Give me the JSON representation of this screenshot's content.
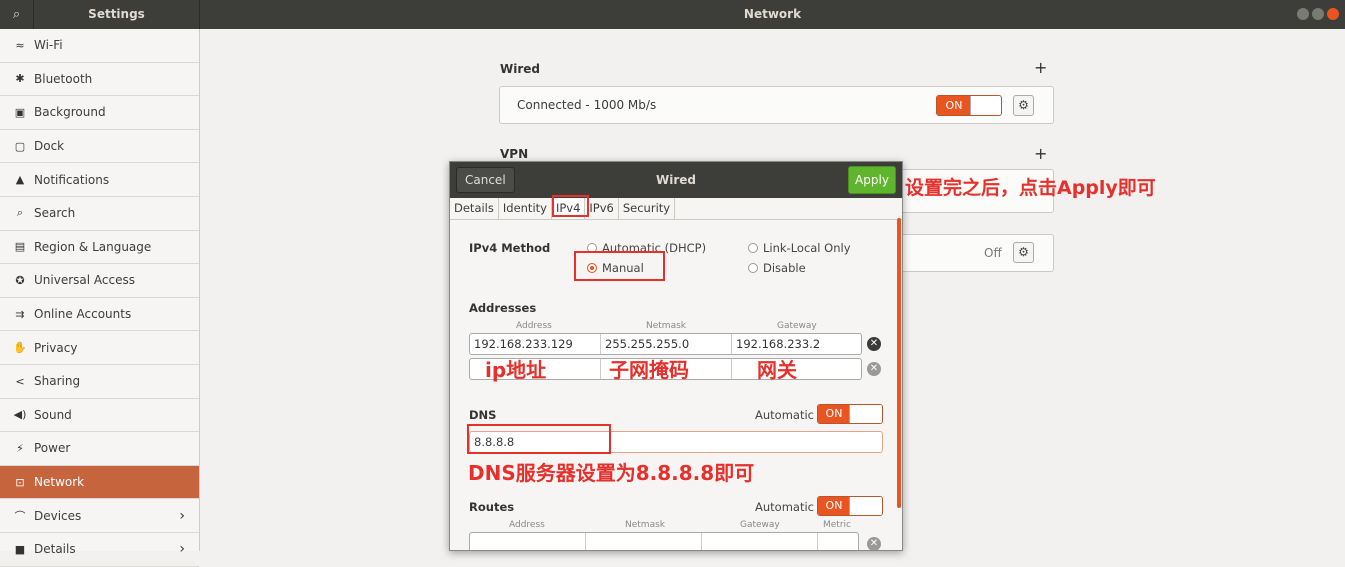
{
  "topbar": {
    "search_icon": "search-icon",
    "settings_title": "Settings",
    "network_title": "Network"
  },
  "sidebar": {
    "items": [
      {
        "icon": "≈",
        "label": "Wi-Fi"
      },
      {
        "icon": "✱",
        "label": "Bluetooth"
      },
      {
        "icon": "▣",
        "label": "Background"
      },
      {
        "icon": "▢",
        "label": "Dock"
      },
      {
        "icon": "▲",
        "label": "Notifications"
      },
      {
        "icon": "⌕",
        "label": "Search"
      },
      {
        "icon": "▤",
        "label": "Region & Language"
      },
      {
        "icon": "✪",
        "label": "Universal Access"
      },
      {
        "icon": "⇉",
        "label": "Online Accounts"
      },
      {
        "icon": "✋",
        "label": "Privacy"
      },
      {
        "icon": "<",
        "label": "Sharing"
      },
      {
        "icon": "◀)",
        "label": "Sound"
      },
      {
        "icon": "⚡",
        "label": "Power"
      },
      {
        "icon": "⊡",
        "label": "Network"
      },
      {
        "icon": "⌒",
        "label": "Devices"
      },
      {
        "icon": "■",
        "label": "Details"
      }
    ],
    "active": "Network",
    "chevron": "›"
  },
  "main": {
    "wired": {
      "title": "Wired",
      "plus": "+",
      "status": "Connected - 1000 Mb/s",
      "toggle": "ON",
      "gear": "⚙"
    },
    "vpn": {
      "title": "VPN",
      "plus": "+"
    },
    "proxy": {
      "toggle": "Off",
      "gear": "⚙"
    }
  },
  "dialog": {
    "cancel": "Cancel",
    "title": "Wired",
    "apply": "Apply",
    "tabs": [
      "Details",
      "Identity",
      "IPv4",
      "IPv6",
      "Security"
    ],
    "ipv4_method_label": "IPv4 Method",
    "methods": {
      "dhcp": "Automatic (DHCP)",
      "link_local": "Link-Local Only",
      "manual": "Manual",
      "disable": "Disable"
    },
    "addresses_label": "Addresses",
    "col_address": "Address",
    "col_netmask": "Netmask",
    "col_gateway": "Gateway",
    "col_metric": "Metric",
    "address_row": {
      "address": "192.168.233.129",
      "netmask": "255.255.255.0",
      "gateway": "192.168.233.2"
    },
    "dns_label": "DNS",
    "automatic": "Automatic",
    "on": "ON",
    "dns_value": "8.8.8.8",
    "routes_label": "Routes",
    "x": "✕"
  },
  "annotations": {
    "apply_note": "设置完之后，点击Apply即可",
    "ip_note": "ip地址",
    "netmask_note": "子网掩码",
    "gateway_note": "网关",
    "dns_note": "DNS服务器设置为8.8.8.8即可"
  },
  "colors": {
    "accent": "#e95420",
    "apply_green": "#5fb52b",
    "annotation_red": "#e5302b"
  }
}
